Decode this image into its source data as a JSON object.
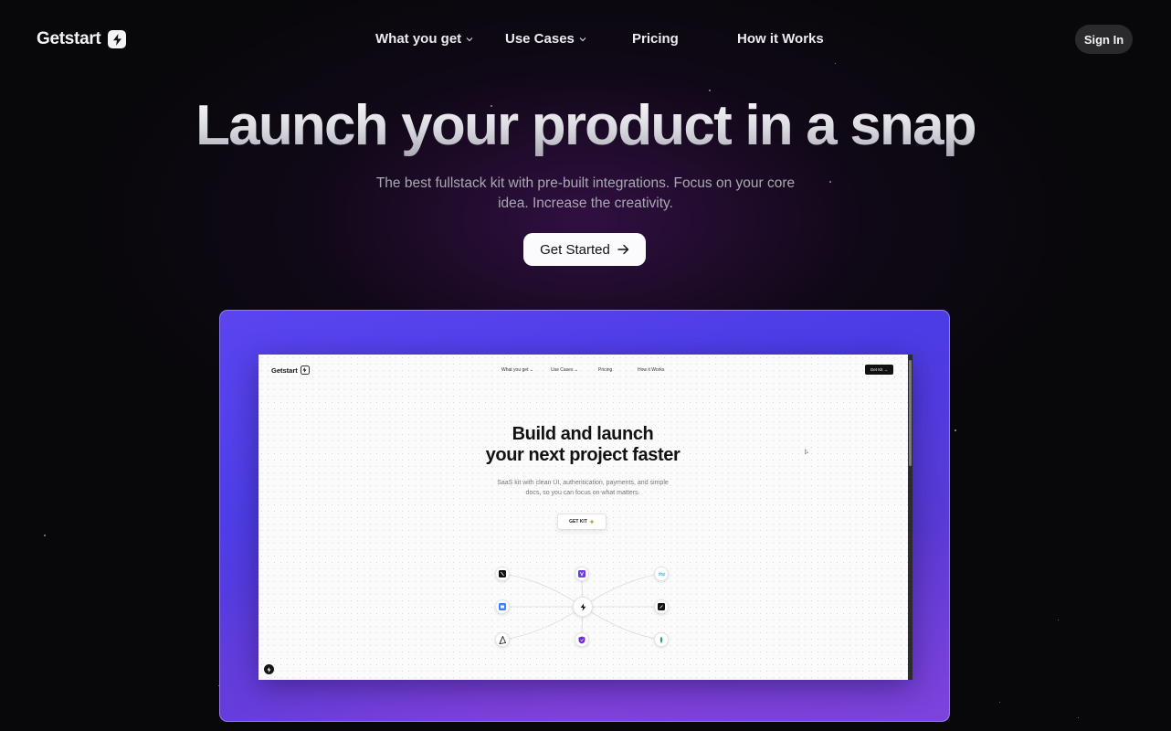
{
  "nav": {
    "logo": "Getstart",
    "items": [
      {
        "label": "What you get",
        "has_dropdown": true
      },
      {
        "label": "Use Cases",
        "has_dropdown": true
      },
      {
        "label": "Pricing",
        "has_dropdown": false
      },
      {
        "label": "How it Works",
        "has_dropdown": false
      }
    ],
    "signin_label": "Sign In"
  },
  "hero": {
    "title": "Launch your product in a snap",
    "subtitle": "The best fullstack kit with pre-built integrations. Focus on your core idea. Increase the creativity.",
    "cta_label": "Get Started"
  },
  "preview": {
    "logo": "Getstart",
    "nav_items": [
      "What you get",
      "Use Cases",
      "Pricing",
      "How it Works"
    ],
    "get_kit_label": "Get Kit",
    "title_line1": "Build and launch",
    "title_line2": "your next project faster",
    "subtitle": "SaaS kit with clean UI, authentication, payments, and simple docs, so you can focus on what matters.",
    "button_label": "GET KIT",
    "diagram_icons": [
      "next-icon",
      "vite-icon",
      "tailwind-icon",
      "db-icon",
      "lightning-icon",
      "shadcn-icon",
      "prisma-icon",
      "shield-icon",
      "mongodb-icon"
    ]
  },
  "colors": {
    "background": "#08070a",
    "accent_purple": "#5a45f0",
    "cta_background": "#fbfbfd"
  }
}
